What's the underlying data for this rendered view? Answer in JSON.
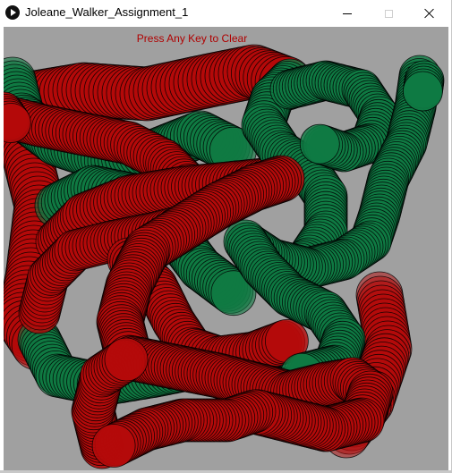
{
  "window": {
    "title": "Joleane_Walker_Assignment_1",
    "icon": "processing-play-icon",
    "controls": [
      "minimize-icon",
      "maximize-icon",
      "close-icon"
    ]
  },
  "sketch": {
    "instruction": "Press Any Key to Clear",
    "colors": {
      "background": "#a0a0a0",
      "red_fill": "#b40a0a",
      "green_fill": "#0f7a43",
      "stroke": "#000000",
      "instruction_text": "#b00000"
    }
  }
}
